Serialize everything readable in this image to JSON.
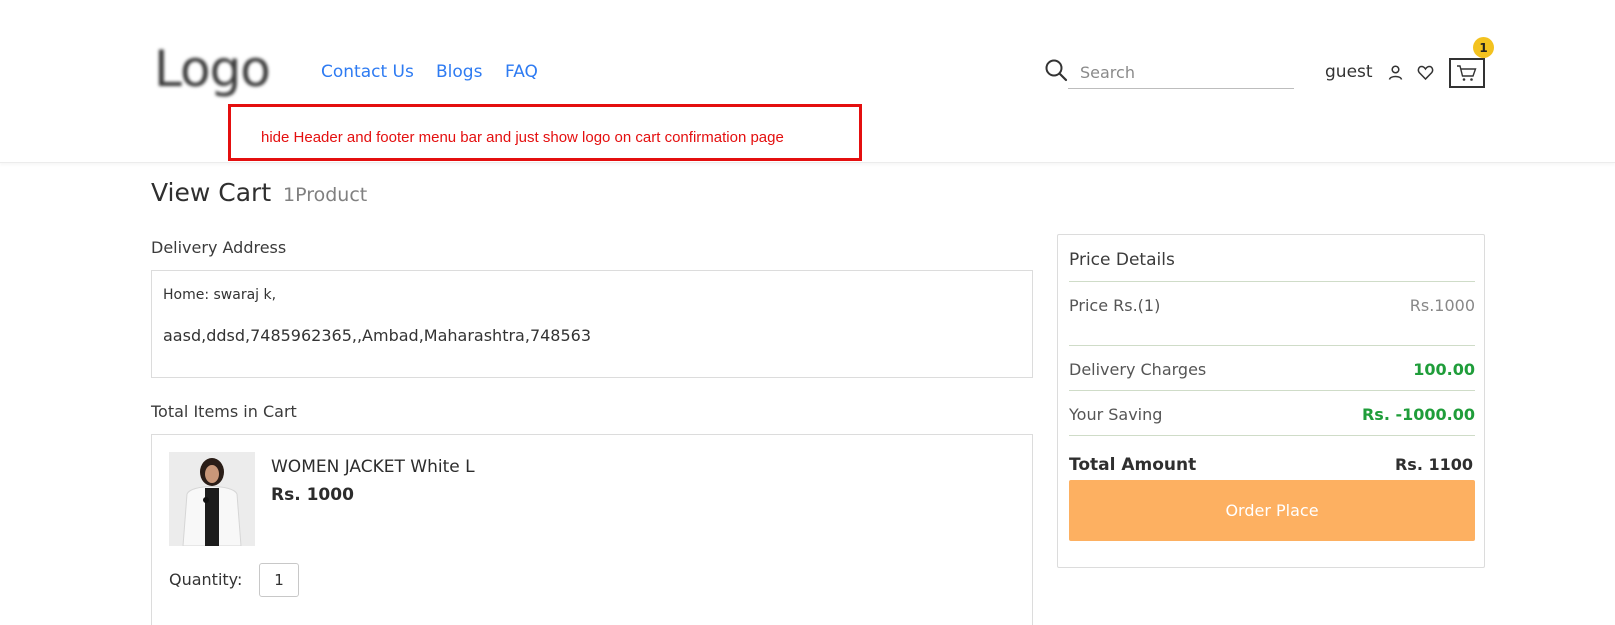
{
  "header": {
    "logo_text": "Logo",
    "nav": {
      "contact": "Contact Us",
      "blogs": "Blogs",
      "faq": "FAQ"
    },
    "search": {
      "placeholder": "Search"
    },
    "user_name": "guest",
    "cart_count": "1"
  },
  "annotation": {
    "text": "hide Header and footer menu bar and just show logo on cart confirmation page",
    "color": "#e40f0f"
  },
  "page": {
    "title": "View Cart",
    "subtitle": "1Product"
  },
  "delivery": {
    "label": "Delivery Address",
    "line1": "Home: swaraj k,",
    "line2": "aasd,ddsd,7485962365,,Ambad,Maharashtra,748563"
  },
  "cart": {
    "label": "Total Items in Cart",
    "items": [
      {
        "name": "WOMEN JACKET White L",
        "price": "Rs. 1000",
        "quantity_label": "Quantity:",
        "quantity": "1"
      }
    ]
  },
  "price_details": {
    "title": "Price Details",
    "rows": [
      {
        "label": "Price Rs.(1)",
        "value": "Rs.1000"
      },
      {
        "label": "Delivery Charges",
        "value": "100.00"
      },
      {
        "label": "Your Saving",
        "value": "Rs. -1000.00"
      }
    ],
    "total_label": "Total Amount",
    "total_value": "Rs. 1100",
    "order_button": "Order Place"
  },
  "colors": {
    "link": "#2e7bf2",
    "badge": "#f3c21f",
    "green": "#1f9d3a",
    "button": "#fdb061"
  },
  "icons": [
    "search-icon",
    "user-icon",
    "heart-icon",
    "cart-icon"
  ]
}
